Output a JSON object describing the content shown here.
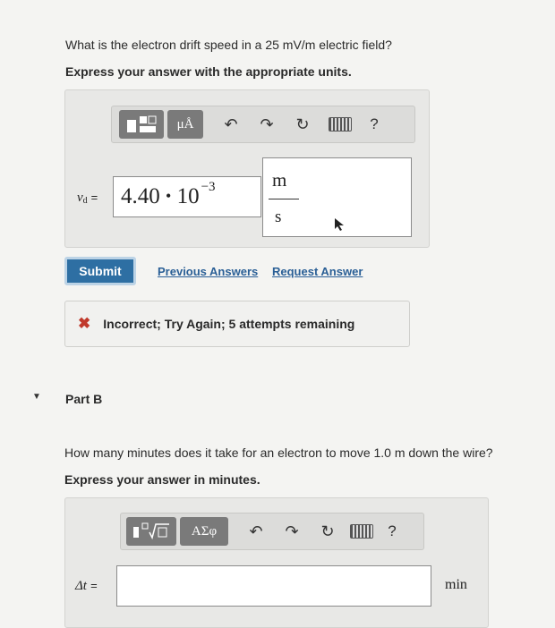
{
  "partA": {
    "question": "What is the electron drift speed in a 25 mV/m electric field?",
    "instruction": "Express your answer with the appropriate units.",
    "toolbar": {
      "units_label": "μÅ",
      "help_label": "?"
    },
    "variable_label": "v",
    "variable_subscript": "d",
    "equals": "=",
    "value_mantissa": "4.40",
    "value_dot": "•",
    "value_base": "10",
    "value_exponent": "−3",
    "unit_numerator": "m",
    "unit_denominator": "s"
  },
  "actions": {
    "submit": "Submit",
    "previous_answers": "Previous Answers",
    "request_answer": "Request Answer"
  },
  "feedback": {
    "icon": "✖",
    "text": "Incorrect; Try Again; 5 attempts remaining"
  },
  "partB": {
    "title": "Part B",
    "question": "How many minutes does it take for an electron to move 1.0 m down the wire?",
    "instruction": "Express your answer in minutes.",
    "toolbar": {
      "symbols_label": "ΑΣφ",
      "help_label": "?"
    },
    "variable_label": "Δt",
    "equals": "=",
    "input_value": "",
    "unit": "min"
  },
  "colors": {
    "submit_bg": "#2e6fa3",
    "link": "#2a5f96",
    "error_x": "#c0392b"
  }
}
